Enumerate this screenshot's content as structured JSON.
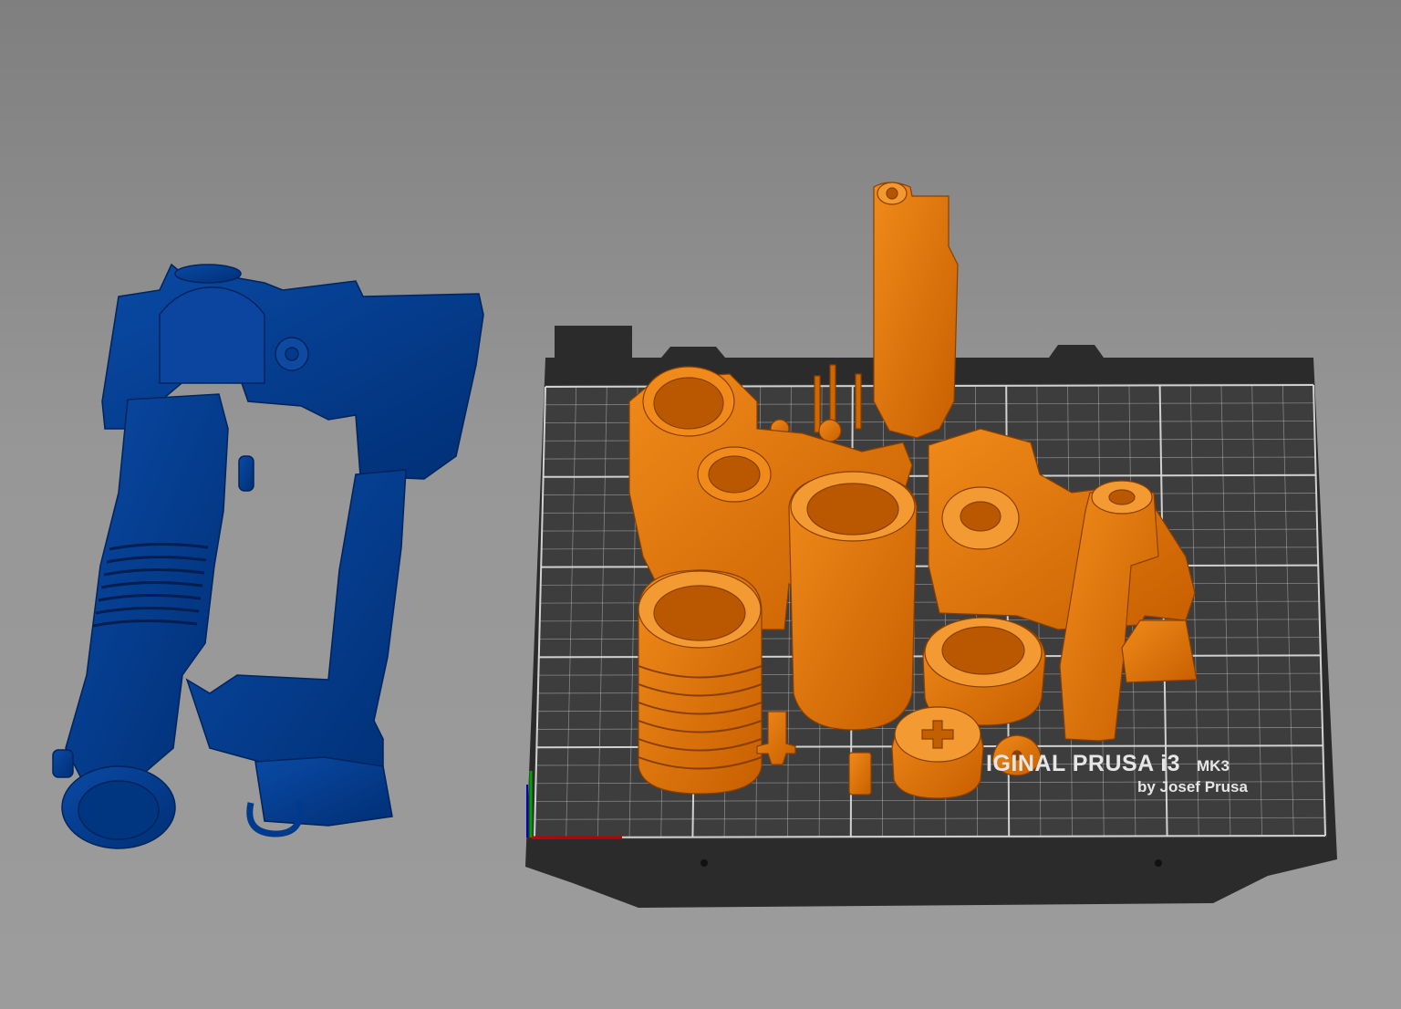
{
  "scene": {
    "background_top": "#7f7f7f",
    "background_bottom": "#9c9c9c"
  },
  "bed": {
    "label_main": "IGINAL PRUSA i3",
    "label_suffix": "MK3",
    "label_sub": "by Josef Prusa",
    "frame_color": "#2b2b2b",
    "plate_color": "#3d3d3d",
    "grid_color": "#d9d9d9"
  },
  "objects": {
    "assembled_color": "#003a8c",
    "parts_color": "#e07000"
  },
  "axes": {
    "x_color": "#c00000",
    "y_color": "#00a000",
    "z_color": "#0000d0"
  }
}
